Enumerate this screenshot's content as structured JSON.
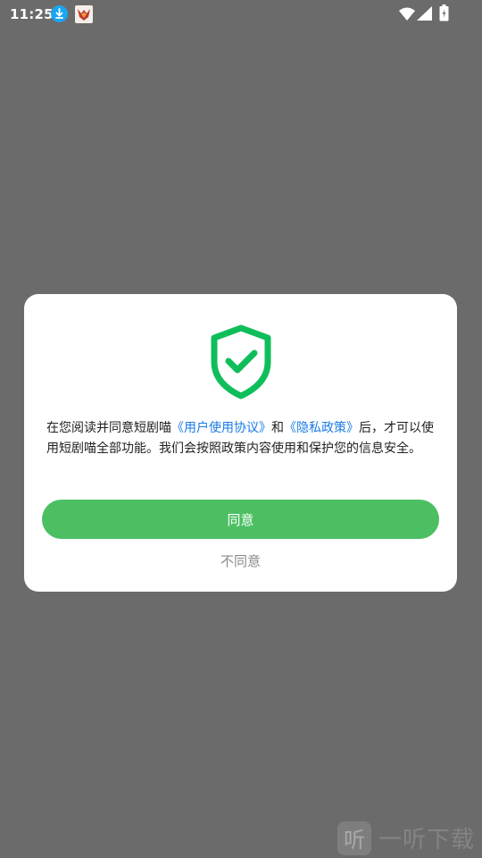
{
  "status_bar": {
    "time": "11:25",
    "icons": [
      "download-icon",
      "app-icon",
      "wifi-icon",
      "signal-icon",
      "battery-icon"
    ]
  },
  "dialog": {
    "icon": "shield-check-icon",
    "icon_color": "#0fbe5a",
    "message": {
      "part1": "在您阅读并同意短剧喵",
      "link1": "《用户使用协议》",
      "part2": "和",
      "link2": "《隐私政策》",
      "part3": "后，才可以使用短剧喵全部功能。我们会按照政策内容使用和保护您的信息安全。"
    },
    "agree_label": "同意",
    "disagree_label": "不同意",
    "agree_color": "#4cbf63",
    "link_color": "#1b7be6"
  },
  "watermark": {
    "logo_glyph": "听",
    "text": "一听下载"
  }
}
